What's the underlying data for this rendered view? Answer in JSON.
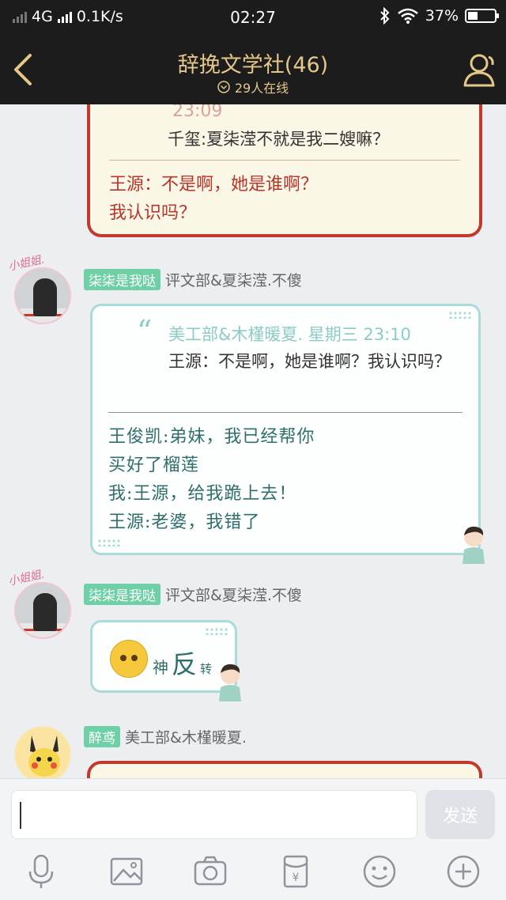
{
  "status_bar": {
    "network": "4G",
    "speed": "0.1K/s",
    "time": "02:27",
    "battery": "37%",
    "battery_level": 0.37
  },
  "header": {
    "title": "辞挽文学社(46)",
    "online": "29人在线"
  },
  "messages": {
    "first_quote": {
      "time": "23:09",
      "text": "千玺:夏柒滢不就是我二嫂嘛？",
      "reply_lines": [
        "王源：不是啊，她是谁啊？",
        "我认识吗？"
      ]
    },
    "second": {
      "avatar_tag": "小姐姐.",
      "badge": "柒柒是我哒",
      "nickname": "评文部&夏柒滢.不傻",
      "quote_author": "美工部&木槿暖夏. 星期三 23:10",
      "quote_body": "王源：不是啊，她是谁啊？我认识吗？",
      "reply_lines": [
        "王俊凯:弟妹，我已经帮你",
        "买好了榴莲",
        "我:王源，给我跪上去！",
        "王源:老婆，我错了"
      ]
    },
    "third": {
      "avatar_tag": "小姐姐.",
      "badge": "柒柒是我哒",
      "nickname": "评文部&夏柒滢.不傻",
      "sticker_words": [
        "神",
        "反",
        "转"
      ]
    },
    "fourth": {
      "badge": "醉鸢",
      "nickname": "美工部&木槿暖夏."
    }
  },
  "input": {
    "send_label": "发送"
  },
  "toolbar": {
    "items": [
      "microphone-icon",
      "image-icon",
      "camera-icon",
      "red-packet-icon",
      "emoji-icon",
      "plus-icon"
    ]
  },
  "colors": {
    "header_bg": "#1c1c1c",
    "header_text": "#e5c787",
    "badge_green": "#6fcfa6",
    "red_card_border": "#c23a2e",
    "teal_card_border": "#a9dcd8"
  }
}
